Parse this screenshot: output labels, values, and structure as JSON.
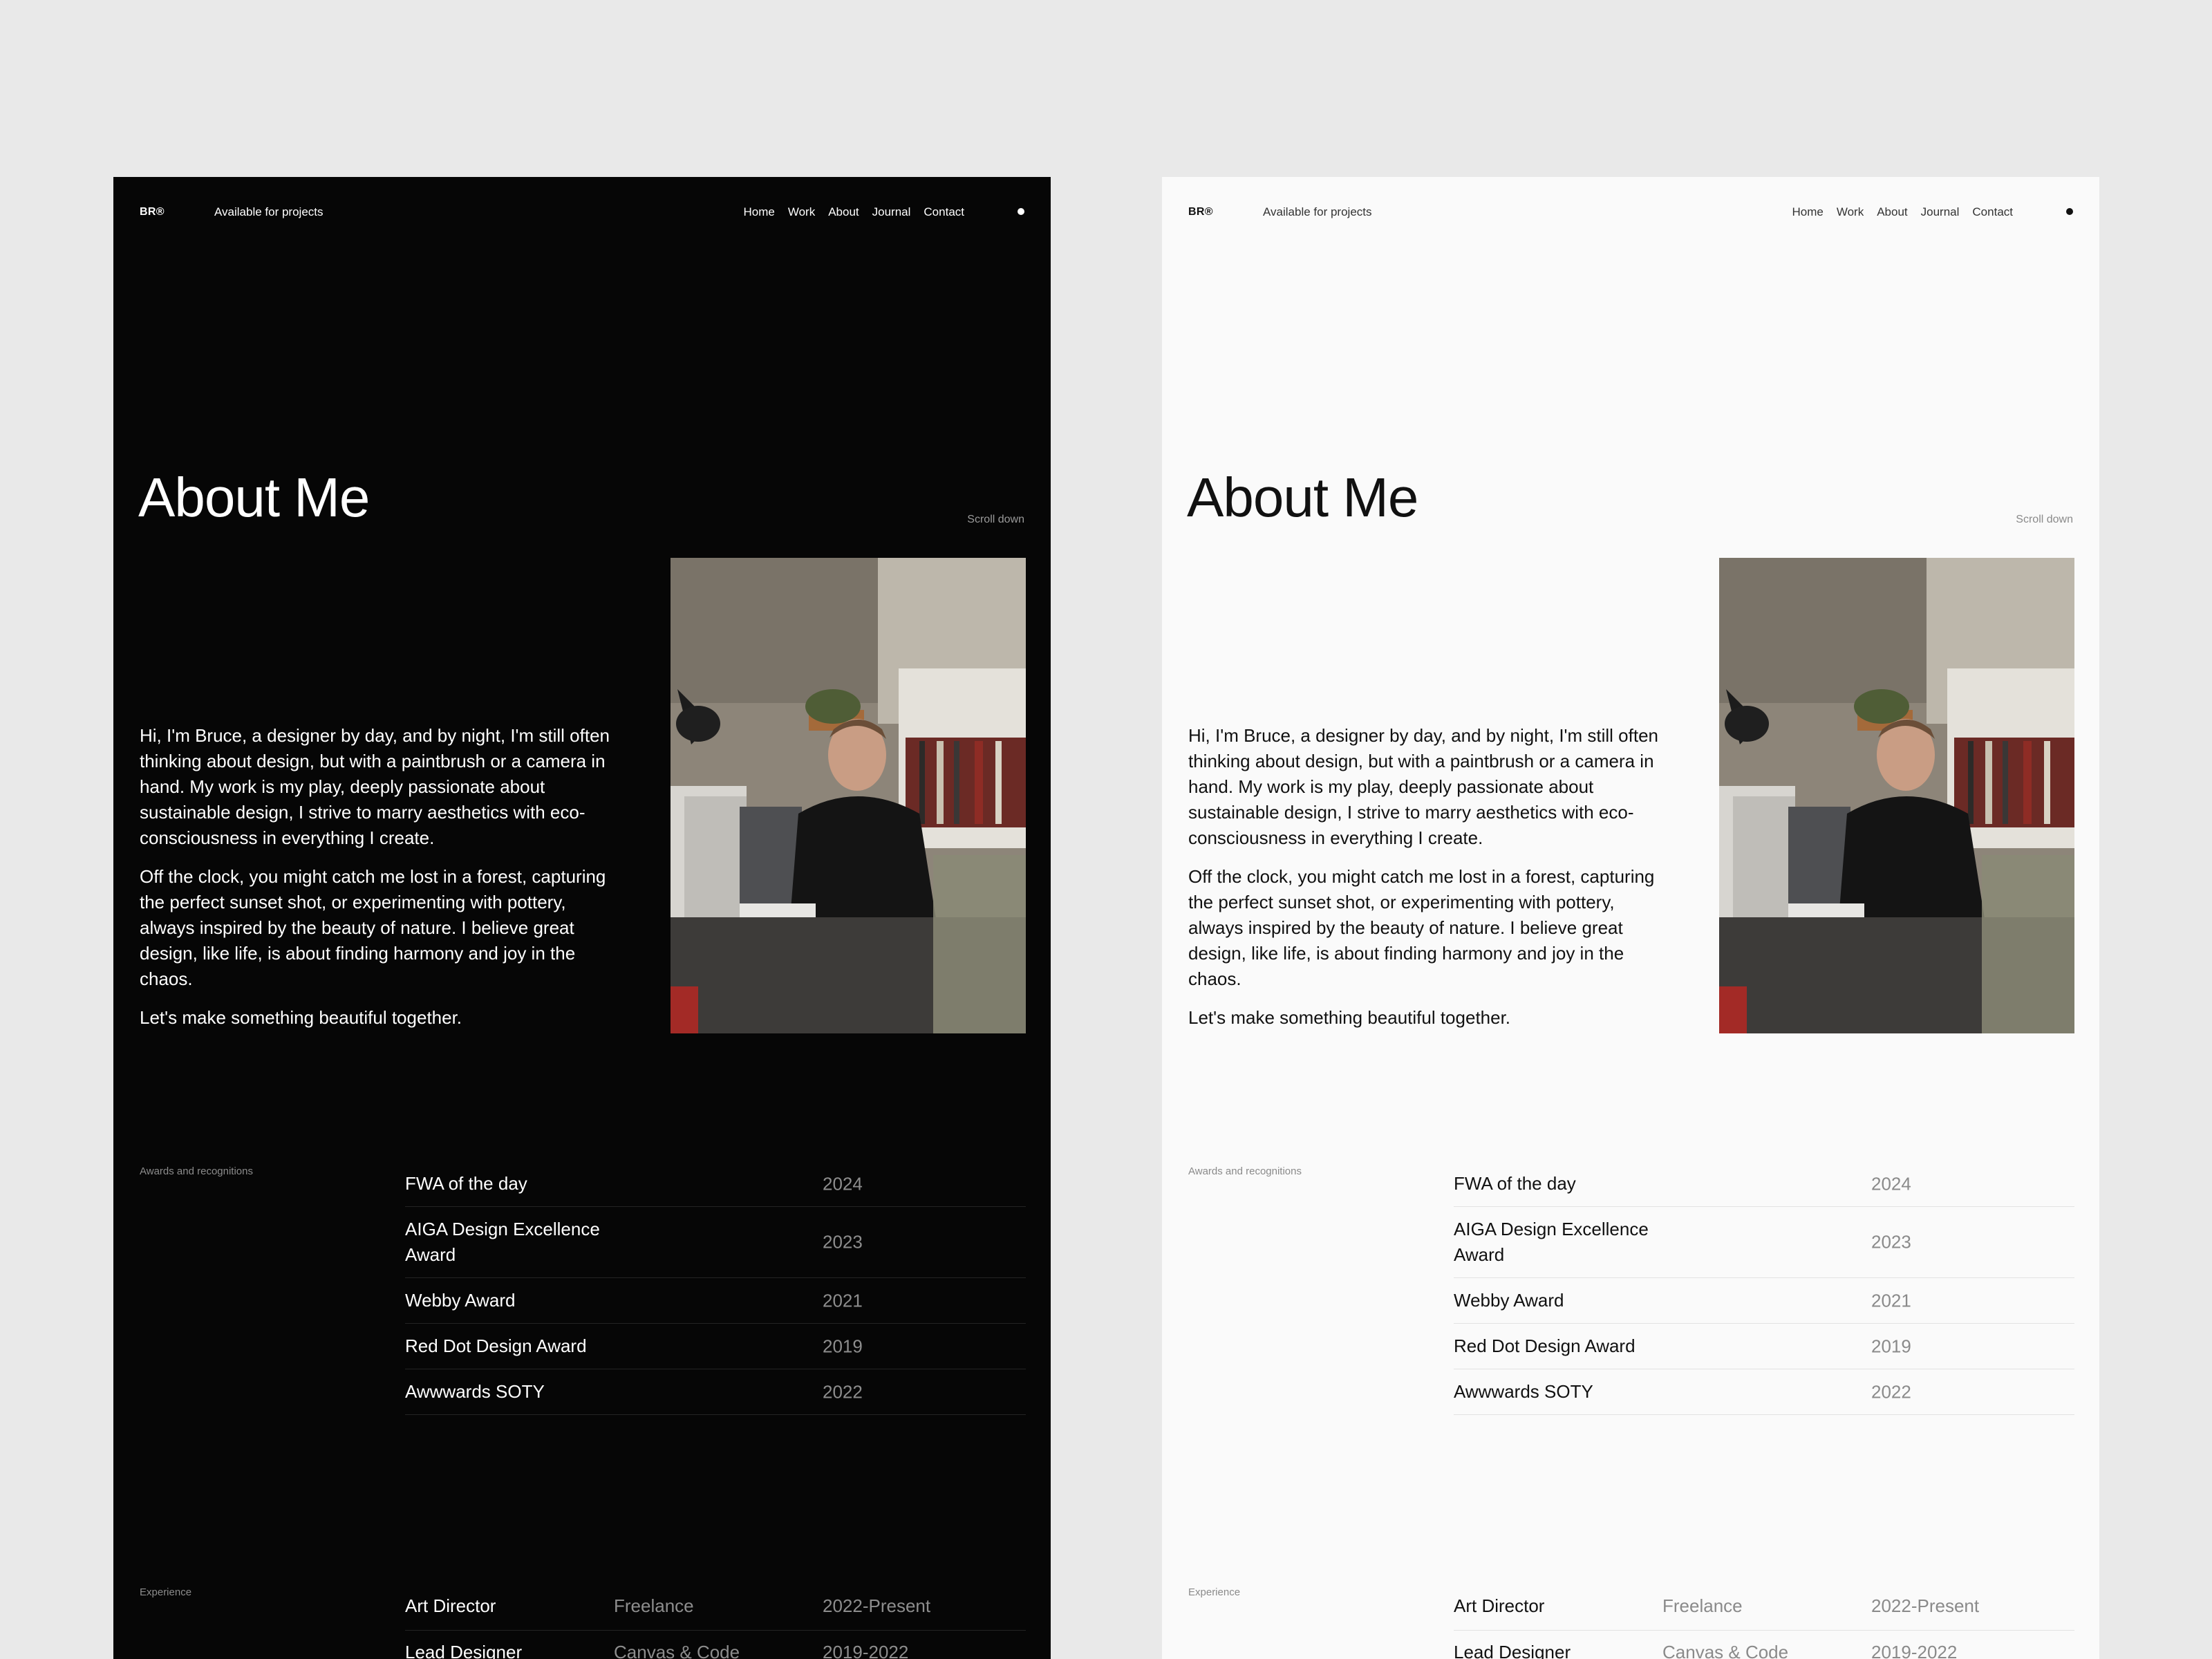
{
  "nav": {
    "brand": "BR®",
    "status": "Available for projects",
    "menu": [
      "Home",
      "Work",
      "About",
      "Journal",
      "Contact"
    ]
  },
  "hero": {
    "title": "About Me",
    "scroll_hint": "Scroll down"
  },
  "bio": {
    "paragraphs": [
      "Hi, I'm Bruce, a designer by day, and by night, I'm still often thinking about design, but with a paintbrush or a camera in hand. My work is my play, deeply passionate about sustainable design, I strive to marry aesthetics with eco-consciousness in everything I create.",
      "Off the clock, you might catch me lost in a forest, capturing the perfect sunset shot, or experimenting with pottery, always inspired by the beauty of nature. I believe great design, like life, is about finding harmony and joy in the chaos.",
      "Let's make something beautiful together."
    ]
  },
  "awards": {
    "label": "Awards and recognitions",
    "items": [
      {
        "name": "FWA of the day",
        "year": "2024"
      },
      {
        "name": "AIGA Design Excellence Award",
        "year": "2023"
      },
      {
        "name": "Webby Award",
        "year": "2021"
      },
      {
        "name": "Red Dot Design Award",
        "year": "2019"
      },
      {
        "name": "Awwwards SOTY",
        "year": "2022"
      }
    ]
  },
  "experience": {
    "label": "Experience",
    "items": [
      {
        "role": "Art Director",
        "company": "Freelance",
        "period": "2022-Present"
      },
      {
        "role": "Lead Designer",
        "company": "Canvas & Code",
        "period": "2019-2022"
      }
    ]
  },
  "themes": {
    "dark": {
      "background": "#060606",
      "text": "#ffffff"
    },
    "light": {
      "background": "#fafafa",
      "text": "#111111"
    }
  }
}
